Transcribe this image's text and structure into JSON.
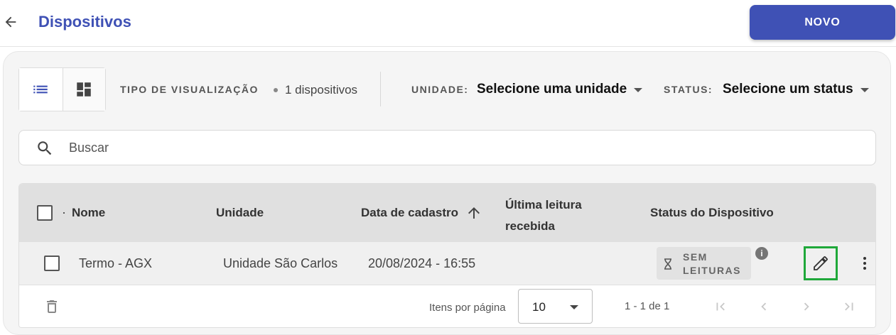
{
  "header": {
    "title": "Dispositivos",
    "new_button": "NOVO"
  },
  "toolbar": {
    "view_label": "TIPO DE VISUALIZAÇÃO",
    "count": "1 dispositivos",
    "unit_label": "UNIDADE:",
    "unit_value": "Selecione uma unidade",
    "status_label": "STATUS:",
    "status_value": "Selecione um status"
  },
  "search": {
    "placeholder": "Buscar"
  },
  "table": {
    "columns": [
      "Nome",
      "Unidade",
      "Data de cadastro",
      "Última leitura recebida",
      "Status do Dispositivo"
    ],
    "sort_column": "Data de cadastro",
    "rows": [
      {
        "name": "Termo - AGX",
        "unit": "Unidade São Carlos",
        "registered": "20/08/2024 - 16:55",
        "last_reading": "",
        "status": "SEM LEITURAS"
      }
    ]
  },
  "footer": {
    "items_per_page_label": "Itens por página",
    "items_per_page": "10",
    "range": "1 - 1 de 1"
  },
  "colors": {
    "primary": "#3f51b5",
    "edit_highlight": "#1fa83a"
  }
}
